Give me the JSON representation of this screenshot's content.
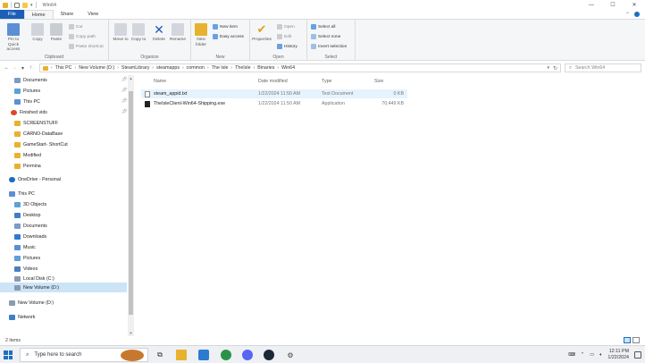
{
  "window": {
    "title": "Win64",
    "controls": {
      "minimize": "—",
      "maximize": "☐",
      "close": "✕"
    }
  },
  "ribbon_tabs": [
    "File",
    "Home",
    "Share",
    "View"
  ],
  "ribbon": {
    "clipboard": {
      "label": "Clipboard",
      "pin": "Pin to Quick access",
      "copy": "Copy",
      "paste": "Paste",
      "cut": "Cut",
      "copy_path": "Copy path",
      "paste_shortcut": "Paste shortcut"
    },
    "organize": {
      "label": "Organize",
      "move_to": "Move to",
      "copy_to": "Copy to",
      "delete": "Delete",
      "rename": "Rename"
    },
    "new": {
      "label": "New",
      "new_folder": "New folder",
      "new_item": "New item",
      "easy_access": "Easy access"
    },
    "open": {
      "label": "Open",
      "properties": "Properties",
      "open": "Open",
      "edit": "Edit",
      "history": "History"
    },
    "select": {
      "label": "Select",
      "select_all": "Select all",
      "select_none": "Select none",
      "invert": "Invert selection"
    }
  },
  "address": {
    "breadcrumbs": [
      "This PC",
      "New Volume (D:)",
      "SteamLibrary",
      "steamapps",
      "common",
      "The Isle",
      "TheIsle",
      "Binaries",
      "Win64"
    ],
    "search_placeholder": "Search Win64"
  },
  "nav": {
    "quick": [
      {
        "label": "Documents",
        "pinned": true
      },
      {
        "label": "Pictures",
        "pinned": true
      },
      {
        "label": "This PC",
        "pinned": true
      },
      {
        "label": "Finished vids",
        "pinned": true
      },
      {
        "label": "SCREENSTUFF",
        "pinned": false
      },
      {
        "label": "CARNO-DataBase",
        "pinned": false
      },
      {
        "label": "GameStart- ShortCut",
        "pinned": false
      },
      {
        "label": "Modified",
        "pinned": false
      },
      {
        "label": "Permina",
        "pinned": false
      }
    ],
    "onedrive": "OneDrive - Personal",
    "thispc": "This PC",
    "thispc_items": [
      "3D Objects",
      "Desktop",
      "Documents",
      "Downloads",
      "Music",
      "Pictures",
      "Videos",
      "Local Disk (C:)",
      "New Volume (D:)"
    ],
    "new_volume": "New Volume (D:)",
    "network": "Network"
  },
  "columns": {
    "name": "Name",
    "date": "Date modified",
    "type": "Type",
    "size": "Size"
  },
  "files": [
    {
      "name": "steam_appid.txt",
      "date": "1/22/2024 11:50 AM",
      "type": "Text Document",
      "size": "0 KB",
      "kind": "txt"
    },
    {
      "name": "TheIsleClient-Win64-Shipping.exe",
      "date": "1/22/2024 11:50 AM",
      "type": "Application",
      "size": "70,449 KB",
      "kind": "exe"
    }
  ],
  "status": {
    "count": "2 items"
  },
  "taskbar": {
    "search": "Type here to search",
    "time": "12:11 PM",
    "date": "1/22/2024"
  },
  "colors": {
    "accent": "#1b5fb8",
    "selection": "#cce4f7",
    "folder": "#e8b22f"
  }
}
